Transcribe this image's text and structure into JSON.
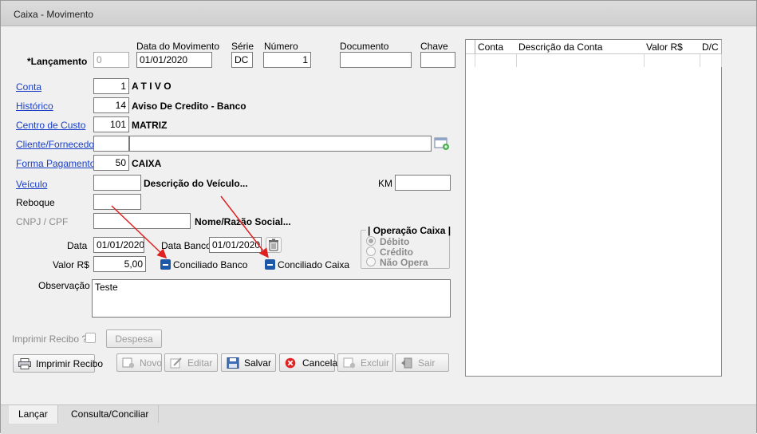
{
  "window": {
    "title": "Caixa - Movimento"
  },
  "form": {
    "header_labels": {
      "data_movimento": "Data do Movimento",
      "serie": "Série",
      "numero": "Número",
      "documento": "Documento",
      "chave": "Chave"
    },
    "lancamento": {
      "label": "*Lançamento",
      "value": "0",
      "data": "01/01/2020",
      "serie": "DC",
      "numero": "1",
      "documento": "",
      "chave": ""
    },
    "conta": {
      "label": "Conta",
      "code": "1",
      "desc": "A T I V O"
    },
    "historico": {
      "label": "Histórico",
      "code": "14",
      "desc": "Aviso De Credito - Banco"
    },
    "centro_custo": {
      "label": "Centro de Custo",
      "code": "101",
      "desc": "MATRIZ"
    },
    "cliente": {
      "label": "Cliente/Fornecedor",
      "code": "",
      "name": ""
    },
    "forma_pagamento": {
      "label": "Forma Pagamento",
      "code": "50",
      "desc": "CAIXA"
    },
    "veiculo": {
      "label": "Veículo",
      "code": "",
      "desc": "Descrição do Veículo...",
      "km_label": "KM",
      "km": ""
    },
    "reboque": {
      "label": "Reboque",
      "value": ""
    },
    "cnpj": {
      "label": "CNPJ / CPF",
      "value": "",
      "desc": "Nome/Razão Social..."
    },
    "data": {
      "label": "Data",
      "value": "01/01/2020"
    },
    "data_banco": {
      "label": "Data Banco",
      "value": "01/01/2020"
    },
    "valor": {
      "label": "Valor R$",
      "value": "5,00"
    },
    "conciliado_banco": "Conciliado Banco",
    "conciliado_caixa": "Conciliado Caixa",
    "operacao": {
      "title": "| Operação Caixa |",
      "options": [
        "Débito",
        "Crédito",
        "Não Opera"
      ],
      "selected": "Débito"
    },
    "observacao": {
      "label": "Observação",
      "value": "Teste"
    },
    "imprimir_recibo_check": "Imprimir Recibo ?",
    "despesa": "Despesa"
  },
  "toolbar": {
    "imprimir": "Imprimir Recibo",
    "novo": "Novo",
    "editar": "Editar",
    "salvar": "Salvar",
    "cancelar": "Cancelar",
    "excluir": "Excluir",
    "sair": "Sair"
  },
  "grid": {
    "columns": [
      "Conta",
      "Descrição da Conta",
      "Valor R$",
      "D/C"
    ],
    "rows": []
  },
  "tabs": [
    "Lançar",
    "Consulta/Conciliar"
  ],
  "colors": {
    "link": "#1a3fc7",
    "checkbox": "#1d58a8",
    "annotation_arrow": "#e02020"
  }
}
